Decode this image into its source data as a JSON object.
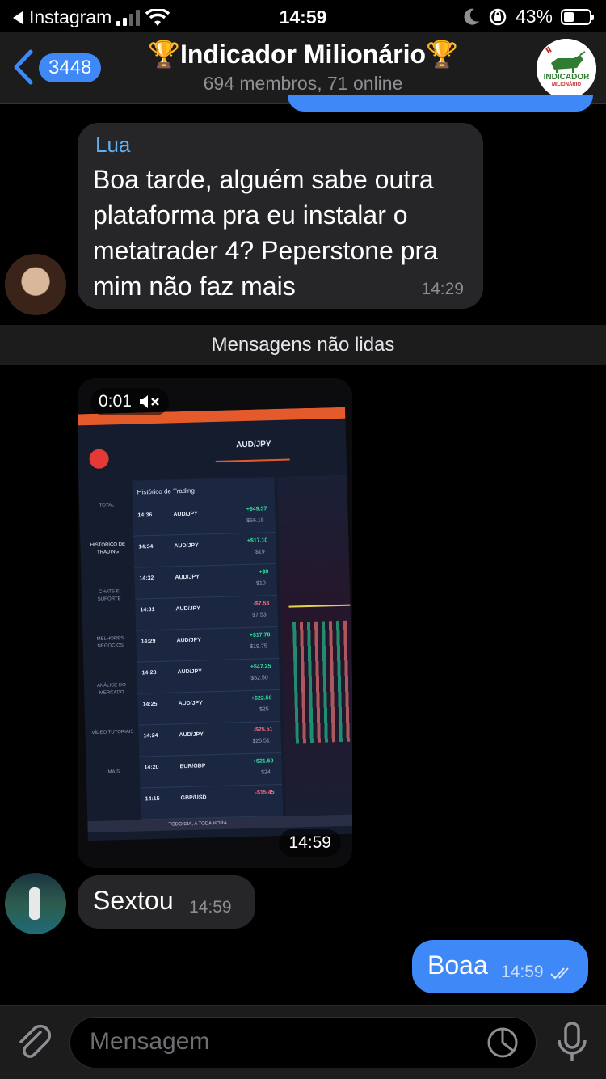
{
  "status_bar": {
    "back_app": "Instagram",
    "time": "14:59",
    "battery": "43%",
    "battery_level": 0.43
  },
  "header": {
    "back_count": "3448",
    "title": "🏆Indicador Milionário🏆",
    "subtitle": "694 membros, 71 online",
    "avatar_text_top": "INDICADOR",
    "avatar_text_bottom": "MILIONÁRIO"
  },
  "messages": {
    "lua": {
      "sender": "Lua",
      "text_lines": [
        "Boa tarde, alguém sabe outra",
        "plataforma pra eu instalar o",
        "metatrader 4? Peperstone pra",
        "mim não faz mais"
      ],
      "time": "14:29"
    },
    "unread_label": "Mensagens não lidas",
    "video": {
      "duration": "0:01",
      "time": "14:59",
      "screen": {
        "pair_top": "AUD/JPY",
        "panel_title": "Histórico de Trading",
        "ticker": "TODO DIA, A TODA HORA",
        "side_menu": [
          "TOTAL",
          "HISTÓRICO DE TRADING",
          "CHATS E SUPORTE",
          "MELHORES NEGÓCIOS",
          "ANÁLISE DO MERCADO",
          "VÍDEO TUTORIAIS",
          "MAIS"
        ],
        "trades": [
          {
            "time": "14:36",
            "pair": "AUD/JPY",
            "profit": "+$49.37",
            "amount": "$56.18",
            "up": true
          },
          {
            "time": "14:34",
            "pair": "AUD/JPY",
            "profit": "+$17.10",
            "amount": "$19",
            "up": false
          },
          {
            "time": "14:32",
            "pair": "AUD/JPY",
            "profit": "+$9",
            "amount": "$10",
            "up": false
          },
          {
            "time": "14:31",
            "pair": "AUD/JPY",
            "profit": "-$7.53",
            "amount": "$7.53",
            "up": false
          },
          {
            "time": "14:29",
            "pair": "AUD/JPY",
            "profit": "+$17.78",
            "amount": "$19.75",
            "up": true
          },
          {
            "time": "14:28",
            "pair": "AUD/JPY",
            "profit": "+$47.25",
            "amount": "$52.50",
            "up": false
          },
          {
            "time": "14:25",
            "pair": "AUD/JPY",
            "profit": "+$22.50",
            "amount": "$25",
            "up": false
          },
          {
            "time": "14:24",
            "pair": "AUD/JPY",
            "profit": "-$25.51",
            "amount": "$25.51",
            "up": false
          },
          {
            "time": "14:20",
            "pair": "EUR/GBP",
            "profit": "+$21.60",
            "amount": "$24",
            "up": false
          },
          {
            "time": "14:15",
            "pair": "GBP/USD",
            "profit": "-$15.45",
            "amount": "",
            "up": false
          }
        ]
      }
    },
    "sextou": {
      "text": "Sextou",
      "time": "14:59"
    },
    "boaa": {
      "text": "Boaa",
      "time": "14:59"
    }
  },
  "composer": {
    "placeholder": "Mensagem"
  },
  "colors": {
    "accent": "#3e88f7",
    "incoming_bubble": "#262628",
    "sender_name": "#5fb0f0"
  }
}
